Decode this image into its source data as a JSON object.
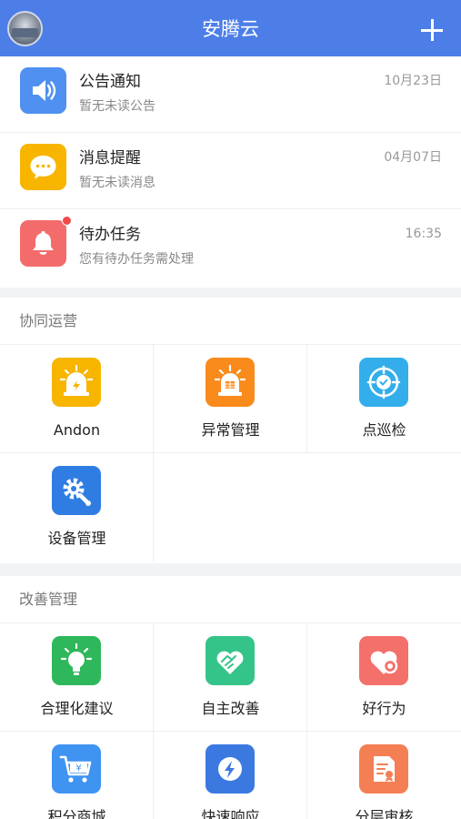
{
  "header": {
    "title": "安腾云"
  },
  "messages": [
    {
      "title": "公告通知",
      "subtitle": "暂无未读公告",
      "time": "10月23日",
      "color": "#4f90f0",
      "icon": "speaker-icon"
    },
    {
      "title": "消息提醒",
      "subtitle": "暂无未读消息",
      "time": "04月07日",
      "color": "#f7b500",
      "icon": "chat-bubble-icon"
    },
    {
      "title": "待办任务",
      "subtitle": "您有待办任务需处理",
      "time": "16:35",
      "color": "#f36b6b",
      "icon": "bell-icon",
      "unread": true
    }
  ],
  "sections": [
    {
      "title": "协同运营",
      "items": [
        {
          "label": "Andon",
          "color": "#f7b500",
          "icon": "alarm-light-icon"
        },
        {
          "label": "异常管理",
          "color": "#f98b1c",
          "icon": "siren-icon"
        },
        {
          "label": "点巡检",
          "color": "#33aeea",
          "icon": "inspection-icon"
        },
        {
          "label": "设备管理",
          "color": "#2f7de2",
          "icon": "gear-wrench-icon"
        }
      ]
    },
    {
      "title": "改善管理",
      "items": [
        {
          "label": "合理化建议",
          "color": "#2fb75b",
          "icon": "lightbulb-icon"
        },
        {
          "label": "自主改善",
          "color": "#34c48a",
          "icon": "handshake-heart-icon"
        },
        {
          "label": "好行为",
          "color": "#f3706b",
          "icon": "heart-badge-icon"
        },
        {
          "label": "积分商城",
          "color": "#3f93f1",
          "icon": "shopping-cart-icon"
        },
        {
          "label": "快速响应",
          "color": "#3b79e0",
          "icon": "lightning-icon"
        },
        {
          "label": "分层审核",
          "color": "#f47f55",
          "icon": "audit-document-icon"
        }
      ]
    }
  ]
}
